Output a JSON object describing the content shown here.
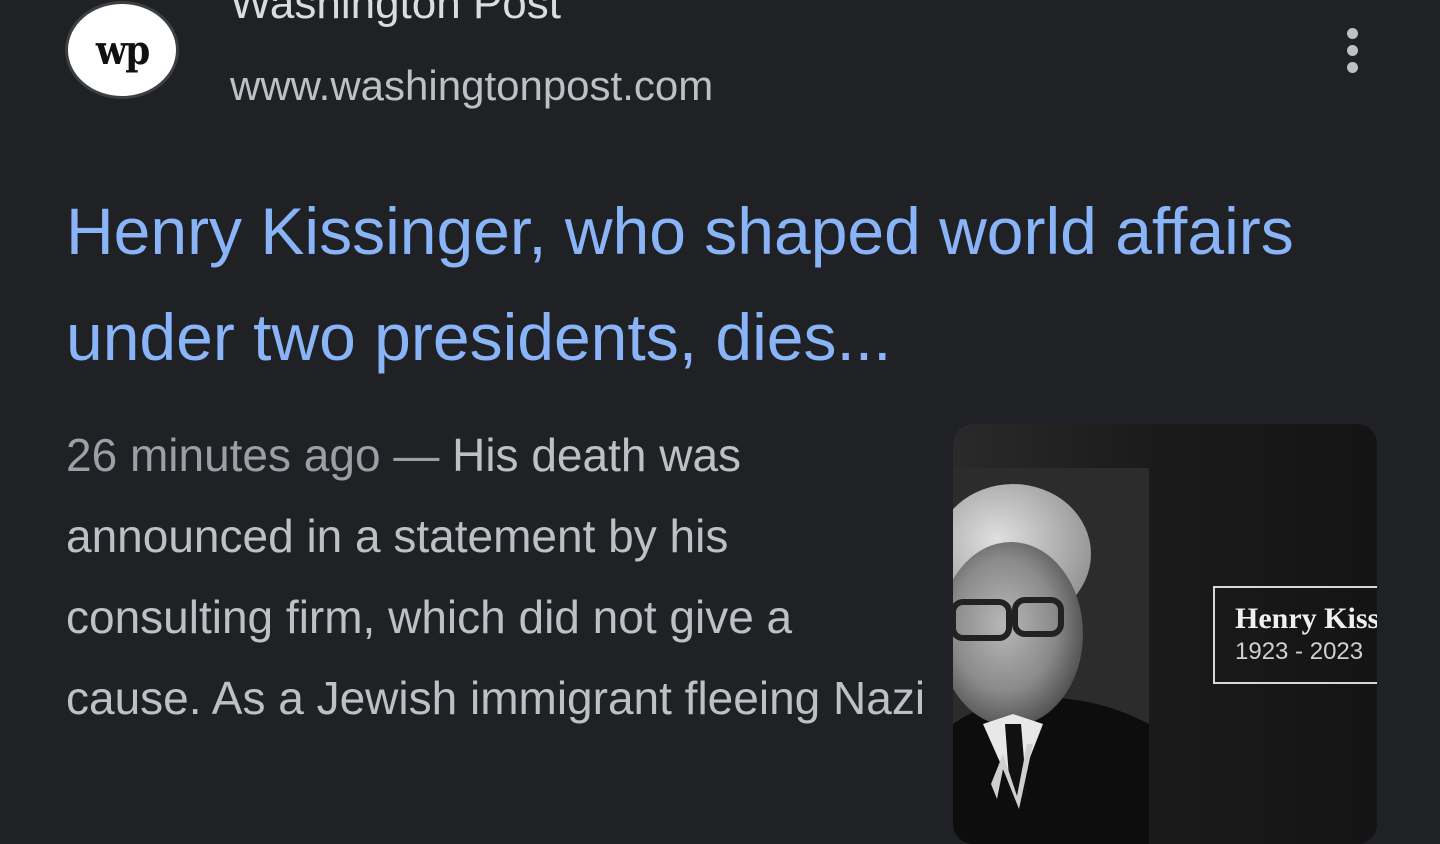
{
  "source": {
    "favicon_text": "wp",
    "name": "Washington Post",
    "url": "www.washingtonpost.com"
  },
  "more_menu_icon": "more-vertical-icon",
  "headline": "Henry Kissinger, who shaped world affairs under two presidents, dies...",
  "snippet": {
    "timestamp": "26 minutes ago",
    "separator": "—",
    "text": "His death was announced in a statement by his consulting firm, which did not give a cause. As a Jewish immigrant fleeing Nazi"
  },
  "thumbnail": {
    "caption_name": "Henry Kissinger",
    "caption_years": "1923 - 2023"
  },
  "colors": {
    "background": "#202124",
    "headline": "#8ab4f8",
    "snippet": "#bdc1c6",
    "url": "#bdc1c6"
  }
}
